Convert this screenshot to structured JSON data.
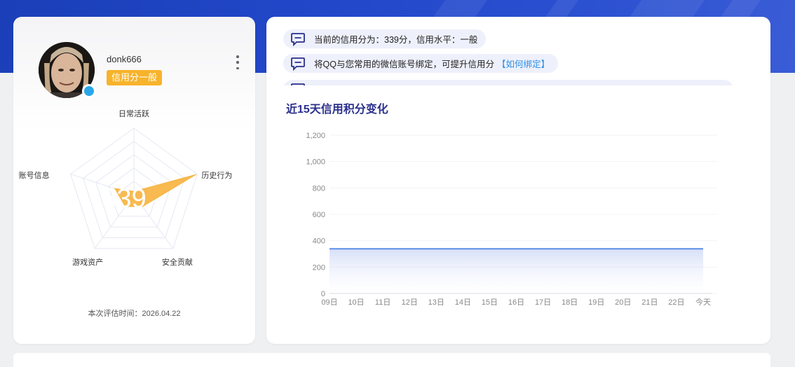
{
  "profile": {
    "username": "donk666",
    "level_badge": "信用分一般",
    "eval_time_label": "本次评估时间：",
    "eval_time": "2026.04.22",
    "score_display": "339",
    "radar": {
      "axes": [
        "日常活跃",
        "历史行为",
        "安全贡献",
        "游戏资产",
        "账号信息"
      ],
      "values": [
        0.05,
        0.98,
        0.22,
        0.22,
        0.3
      ],
      "fill_color": "#f7b23e"
    }
  },
  "notices": [
    {
      "text": "当前的信用分为：339分，信用水平：一般",
      "link": ""
    },
    {
      "text": "将QQ与您常用的微信账号绑定，可提升信用分",
      "link": "【如何绑定】"
    }
  ],
  "chart_data": {
    "type": "area",
    "title": "近15天信用积分变化",
    "x": [
      "09日",
      "10日",
      "11日",
      "12日",
      "13日",
      "14日",
      "15日",
      "16日",
      "17日",
      "18日",
      "19日",
      "20日",
      "21日",
      "22日",
      "今天"
    ],
    "series": [
      {
        "values": [
          339,
          339,
          339,
          339,
          339,
          339,
          339,
          339,
          339,
          339,
          339,
          339,
          339,
          339,
          339
        ],
        "color": "#5b8ee6"
      }
    ],
    "yticks": [
      "0",
      "200",
      "400",
      "600",
      "800",
      "1,000",
      "1,200"
    ],
    "ylim": [
      0,
      1200
    ],
    "grid": true
  },
  "colors": {
    "accent": "#2a2f8c",
    "badge": "#f7b32b",
    "link": "#2d8fe6",
    "hero": "#2247c9"
  }
}
